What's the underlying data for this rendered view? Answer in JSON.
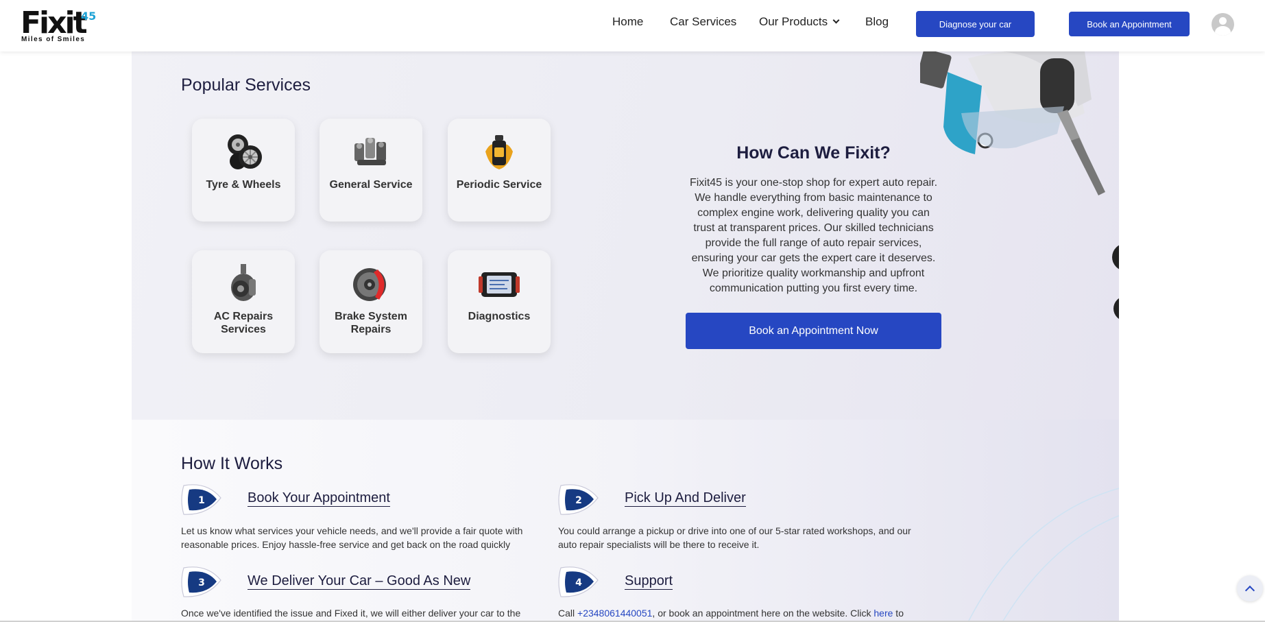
{
  "header": {
    "logo_word": "Fixit",
    "logo_sup": "45",
    "logo_tagline": "Miles of Smiles",
    "nav": [
      "Home",
      "Car Services",
      "Our Products",
      "Blog"
    ],
    "diagnose_label": "Diagnose your car",
    "book_label": "Book an Appointment"
  },
  "popular": {
    "title": "Popular Services",
    "services": [
      {
        "label": "Tyre & Wheels",
        "icon": "tyre-icon"
      },
      {
        "label": "General Service",
        "icon": "engine-parts-icon"
      },
      {
        "label": "Periodic Service",
        "icon": "oil-bottle-icon"
      },
      {
        "label": "AC Repairs Services",
        "icon": "ac-compressor-icon"
      },
      {
        "label": "Brake System Repairs",
        "icon": "brake-disc-icon"
      },
      {
        "label": "Diagnostics",
        "icon": "diagnostic-tablet-icon"
      }
    ]
  },
  "fixit": {
    "title": "How Can We Fixit?",
    "text": "Fixit45 is your one-stop shop for expert auto repair. We handle everything from basic maintenance to complex engine work, delivering quality you can trust at transparent prices. Our skilled technicians provide the full range of auto repair services, ensuring your car gets the expert care it deserves. We prioritize quality workmanship and upfront communication putting you first every time.",
    "button": "Book an Appointment Now"
  },
  "works": {
    "title": "How It Works",
    "steps": [
      {
        "num": "1",
        "title": "Book Your Appointment",
        "desc": "Let us know what services your vehicle needs, and we'll provide a fair quote with reasonable prices. Enjoy hassle-free service and get back on the road quickly"
      },
      {
        "num": "2",
        "title": "Pick Up And Deliver",
        "desc": "You could arrange a pickup or drive into one of our 5-star rated workshops, and our auto repair specialists will be there to receive it."
      },
      {
        "num": "3",
        "title": "We Deliver Your Car – Good As New",
        "desc": "Once we've identified the issue and Fixed it, we will either deliver your car to the"
      },
      {
        "num": "4",
        "title": "Support",
        "desc_prefix": "Call ",
        "phone": "+2348061440051",
        "desc_mid": ", or book an appointment here on the website. Click ",
        "here": "here",
        "desc_suffix": " to"
      }
    ]
  },
  "colors": {
    "accent": "#2647c2",
    "badge": "#163a82",
    "logo_sup": "#1fa3d6"
  }
}
